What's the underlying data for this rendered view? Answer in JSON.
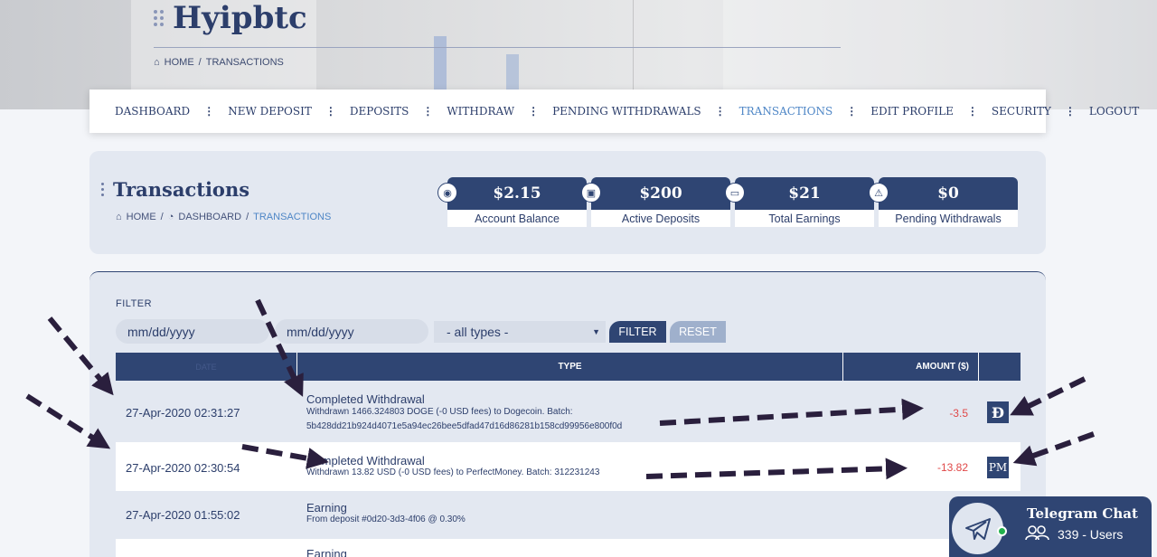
{
  "brand": {
    "name": "Hyipbtc"
  },
  "hero_breadcrumb": {
    "home": "HOME",
    "sep": "/",
    "current": "TRANSACTIONS"
  },
  "nav": {
    "items": [
      "DASHBOARD",
      "NEW DEPOSIT",
      "DEPOSITS",
      "WITHDRAW",
      "PENDING WITHDRAWALS",
      "TRANSACTIONS",
      "EDIT PROFILE",
      "SECURITY",
      "LOGOUT"
    ],
    "active": "TRANSACTIONS",
    "separator": "⋮"
  },
  "page": {
    "title": "Transactions",
    "breadcrumb": {
      "home": "HOME",
      "dashboard": "DASHBOARD",
      "current": "TRANSACTIONS",
      "sep": "/"
    }
  },
  "stats": [
    {
      "value": "$2.15",
      "label": "Account Balance",
      "icon": "piggy-bank-icon"
    },
    {
      "value": "$200",
      "label": "Active Deposits",
      "icon": "deposit-icon"
    },
    {
      "value": "$21",
      "label": "Total Earnings",
      "icon": "money-icon"
    },
    {
      "value": "$0",
      "label": "Pending Withdrawals",
      "icon": "warning-icon"
    }
  ],
  "filter": {
    "label": "FILTER",
    "date_from_placeholder": "mm/dd/yyyy",
    "date_to_placeholder": "mm/dd/yyyy",
    "type_selected": "- all types -",
    "filter_button": "FILTER",
    "reset_button": "RESET"
  },
  "table": {
    "headers": {
      "date": "DATE",
      "type": "TYPE",
      "amount": "AMOUNT ($)"
    },
    "rows": [
      {
        "date": "27-Apr-2020 02:31:27",
        "title": "Completed Withdrawal",
        "desc": "Withdrawn 1466.324803 DOGE (-0 USD fees) to Dogecoin. Batch: 5b428dd21b924d4071e5a94ec26bee5dfad47d16d86281b158cd99956e800f0d",
        "amount": "-3.5",
        "processor_icon": "Đ",
        "processor": "dogecoin-icon"
      },
      {
        "date": "27-Apr-2020 02:30:54",
        "title": "Completed Withdrawal",
        "desc": "Withdrawn 13.82 USD (-0 USD fees) to PerfectMoney. Batch: 312231243",
        "amount": "-13.82",
        "processor_icon": "PM",
        "processor": "perfectmoney-icon"
      },
      {
        "date": "27-Apr-2020 01:55:02",
        "title": "Earning",
        "desc": "From deposit #0d20-3d3-4f06 @ 0.30%",
        "amount": "+",
        "processor_icon": "",
        "processor": ""
      },
      {
        "date": "",
        "title": "Earning",
        "desc": "",
        "amount": "",
        "processor_icon": "",
        "processor": ""
      }
    ]
  },
  "telegram": {
    "title": "Telegram Chat",
    "users": "339 - Users"
  },
  "colors": {
    "primary": "#2f4573",
    "accent": "#4e86c6",
    "negative": "#e04848",
    "panel": "#e3e8f1"
  }
}
